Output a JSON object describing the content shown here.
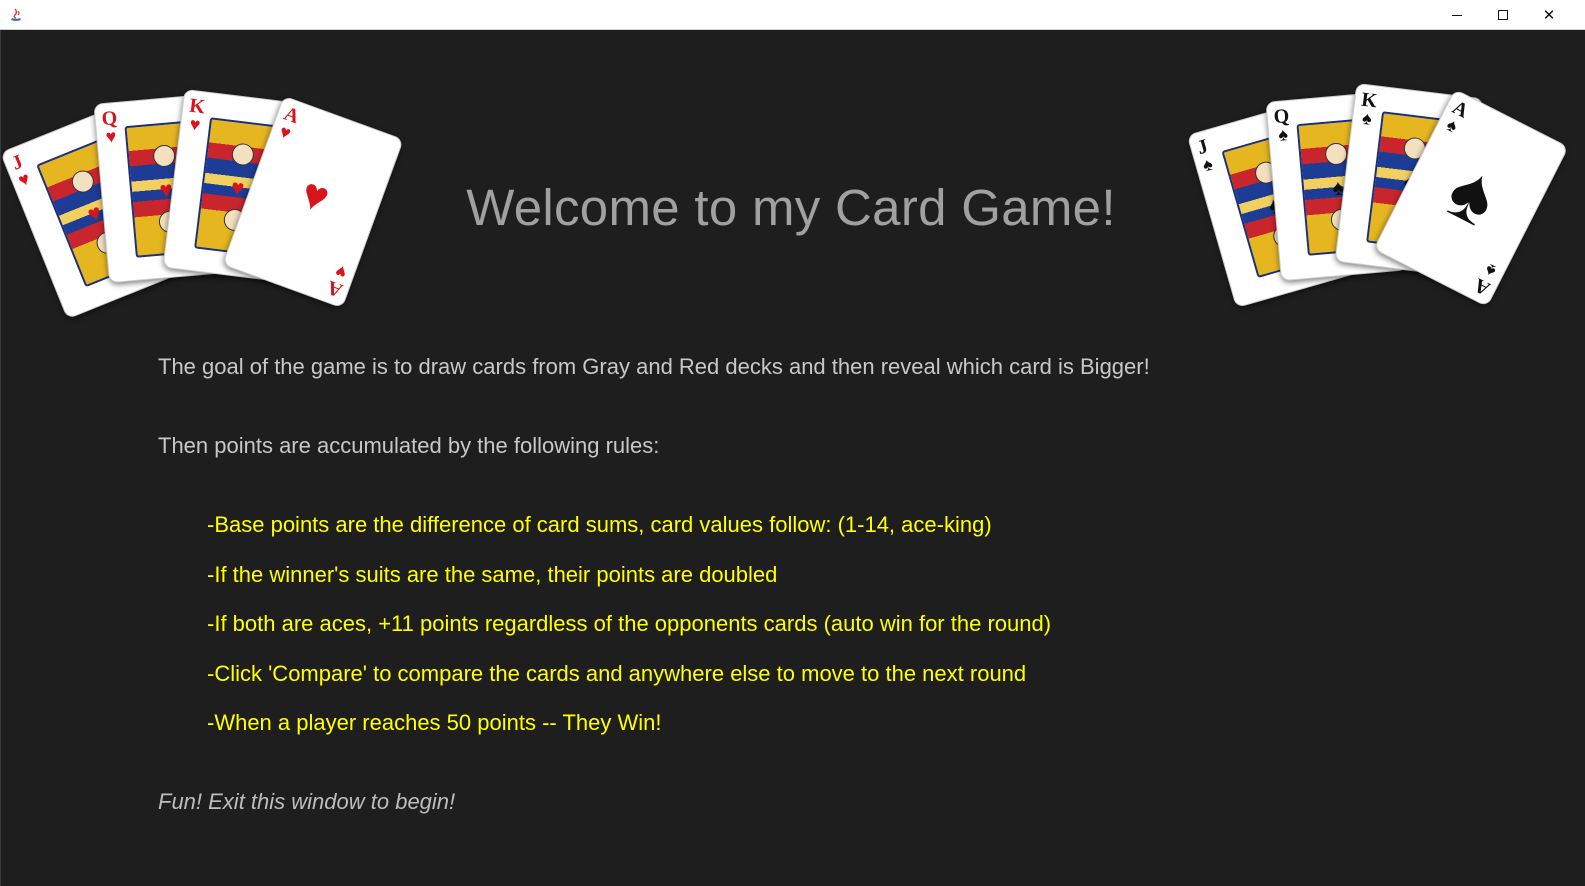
{
  "window": {
    "minimize_glyph": "",
    "close_glyph": "✕"
  },
  "title": "Welcome to my Card Game!",
  "intro": [
    "The goal of the game is to draw cards from Gray and Red decks and then reveal which card is Bigger!",
    "Then points are accumulated by the following rules:"
  ],
  "rules": [
    "-Base points are the difference of card sums, card values follow: (1-14, ace-king)",
    "-If the winner's suits are the same, their points are doubled",
    "-If both are aces, +11 points regardless of the opponents cards (auto win for the round)",
    "-Click 'Compare' to compare the cards and anywhere else to move to the next round",
    "-When a player reaches 50 points -- They Win!"
  ],
  "outro": "Fun! Exit this window to begin!",
  "cards": {
    "left": [
      {
        "rank": "J",
        "suit": "♥"
      },
      {
        "rank": "Q",
        "suit": "♥"
      },
      {
        "rank": "K",
        "suit": "♥"
      },
      {
        "rank": "A",
        "suit": "♥"
      }
    ],
    "right": [
      {
        "rank": "J",
        "suit": "♠"
      },
      {
        "rank": "Q",
        "suit": "♠"
      },
      {
        "rank": "K",
        "suit": "♠"
      },
      {
        "rank": "A",
        "suit": "♠"
      }
    ]
  },
  "colors": {
    "background": "#1e1e1e",
    "title": "#a0a0a0",
    "rules": "#ffff00",
    "intro": "#c8c8c8",
    "hearts": "#d8151d",
    "spades": "#111111"
  }
}
